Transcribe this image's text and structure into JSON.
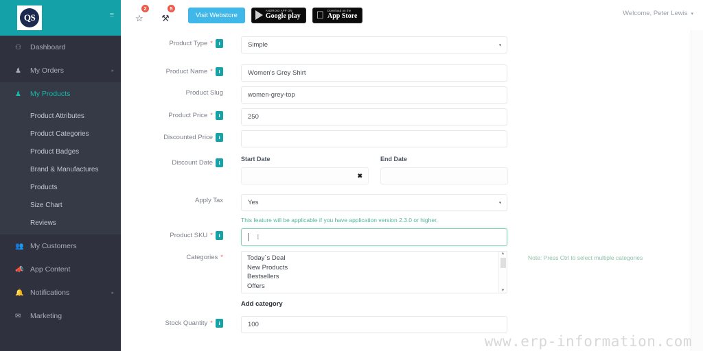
{
  "brand": {
    "logo_text": "QS",
    "logo_name": "qs-logo"
  },
  "sidebar": {
    "items": [
      {
        "label": "Dashboard",
        "icon": "dashboard-icon",
        "glyph": "⚇",
        "active": false
      },
      {
        "label": "My Orders",
        "icon": "orders-icon",
        "glyph": "♟",
        "active": false
      },
      {
        "label": "My Products",
        "icon": "products-icon",
        "glyph": "♟",
        "active": true
      }
    ],
    "submenu": [
      {
        "label": "Product Attributes"
      },
      {
        "label": "Product Categories"
      },
      {
        "label": "Product Badges"
      },
      {
        "label": "Brand & Manufactures"
      },
      {
        "label": "Products"
      },
      {
        "label": "Size Chart"
      },
      {
        "label": "Reviews"
      }
    ],
    "items_lower": [
      {
        "label": "My Customers",
        "icon": "customers-icon",
        "glyph": "♟"
      },
      {
        "label": "App Content",
        "icon": "megaphone-icon",
        "glyph": "◀"
      },
      {
        "label": "Notifications",
        "icon": "bell-icon",
        "glyph": "♟"
      },
      {
        "label": "Marketing",
        "icon": "envelope-icon",
        "glyph": "✉"
      }
    ]
  },
  "topbar": {
    "hamburger_glyph": "≡",
    "icons": [
      {
        "name": "star-icon",
        "glyph": "☆",
        "badge": "2"
      },
      {
        "name": "gavel-icon",
        "glyph": "⚒",
        "badge": "5"
      }
    ],
    "visit_webstore": "Visit Webstore",
    "google_play": {
      "small": "ANDROID APP ON",
      "large": "Google play"
    },
    "app_store": {
      "small": "Download on the",
      "large": "App Store",
      "glyph": "ἴE"
    },
    "welcome": "Welcome, Peter Lewis",
    "welcome_caret": "▾"
  },
  "form": {
    "info_glyph": "i",
    "select_arrow": "▾",
    "rows": {
      "product_type": {
        "label": "Product Type",
        "required": "*",
        "value": "Simple",
        "info": true
      },
      "product_name": {
        "label": "Product Name",
        "required": "*",
        "value": "Women's Grey Shirt",
        "info": true
      },
      "product_slug": {
        "label": "Product Slug",
        "required": "",
        "value": "women-grey-top",
        "info": false
      },
      "product_price": {
        "label": "Product Price",
        "required": "*",
        "value": "250",
        "info": true
      },
      "discounted_price": {
        "label": "Discounted Price",
        "required": "",
        "value": "",
        "info": true
      },
      "discount_date": {
        "label": "Discount Date",
        "required": "",
        "info": true,
        "start_label": "Start Date",
        "start_value": "",
        "clear_glyph": "✖",
        "end_label": "End Date",
        "end_value": ""
      },
      "apply_tax": {
        "label": "Apply Tax",
        "required": "",
        "value": "Yes",
        "info": false,
        "helper": "This feature will be applicable if you have application version 2.3.0 or higher."
      },
      "product_sku": {
        "label": "Product SKU",
        "required": "*",
        "value": "",
        "info": true,
        "ibeam": "I"
      },
      "categories": {
        "label": "Categories",
        "required": "*",
        "info": false,
        "options": [
          "Today`s Deal",
          "New Products",
          "Bestsellers",
          "Offers"
        ],
        "note": "Note: Press Ctrl to select multiple categories",
        "add_category": "Add category",
        "scroll_up": "▲",
        "scroll_down": "▼"
      },
      "stock_quantity": {
        "label": "Stock Quantity",
        "required": "*",
        "value": "100",
        "info": true
      }
    }
  },
  "watermark": "www.erp-information.com",
  "colors": {
    "brand_teal": "#14a2a8",
    "sidebar_bg": "#2f323e",
    "submenu_bg": "#363a47",
    "active_text": "#14b9a8",
    "webstore_blue": "#3fb7e8",
    "badge_red": "#f05a4a",
    "info_badge": "#17a2a8",
    "helper_green": "#55b59a"
  }
}
